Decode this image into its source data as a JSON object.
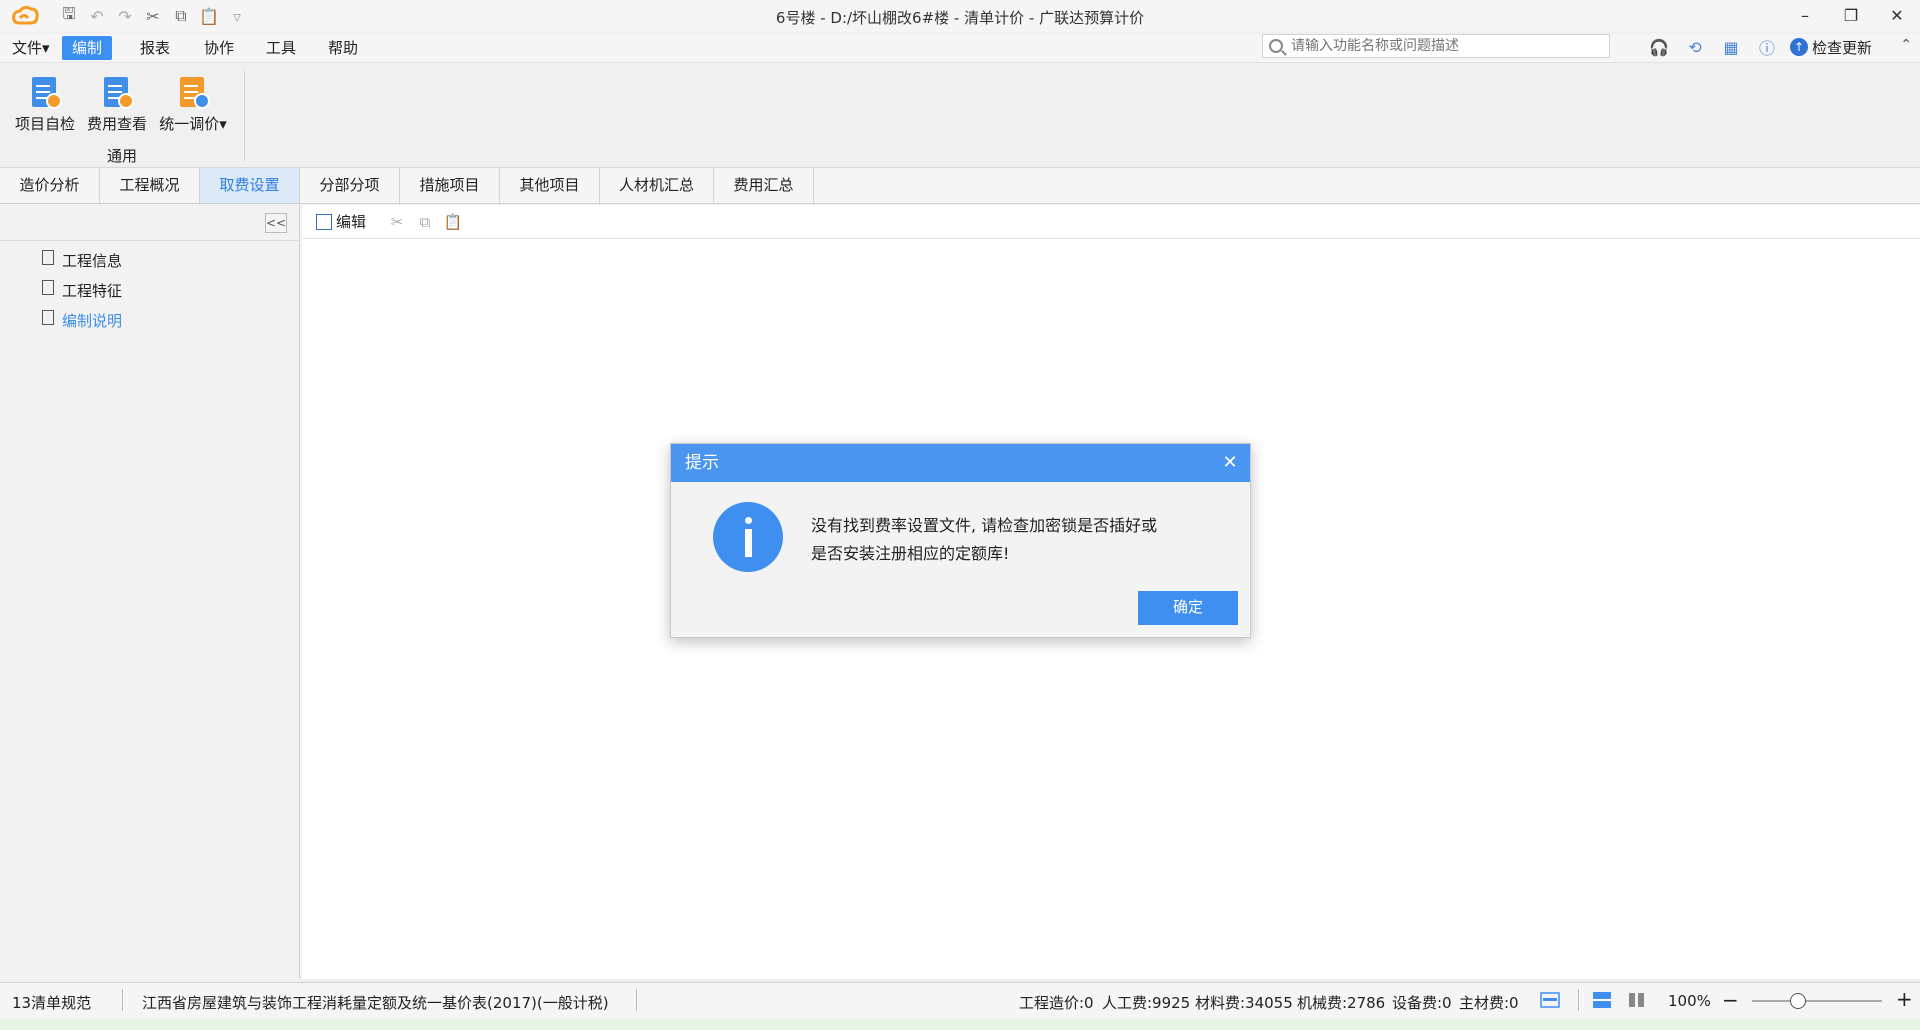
{
  "window": {
    "title": "6号楼 - D:/坏山棚改6#楼 - 清单计价 - 广联达预算计价",
    "minimize": "–",
    "restore": "❐",
    "close": "✕"
  },
  "menu": {
    "items": [
      "文件▾",
      "编制",
      "报表",
      "协作",
      "工具",
      "帮助"
    ],
    "active": "编制"
  },
  "search": {
    "placeholder": "请输入功能名称或问题描述"
  },
  "right_tools": {
    "update_label": "检查更新",
    "collapse": "⌃"
  },
  "ribbon": {
    "buttons": [
      {
        "label": "项目自检"
      },
      {
        "label": "费用查看"
      },
      {
        "label": "统一调价▾"
      }
    ],
    "group_label": "通用"
  },
  "tabs": [
    {
      "label": "造价分析"
    },
    {
      "label": "工程概况"
    },
    {
      "label": "取费设置"
    },
    {
      "label": "分部分项"
    },
    {
      "label": "措施项目"
    },
    {
      "label": "其他项目"
    },
    {
      "label": "人材机汇总"
    },
    {
      "label": "费用汇总"
    }
  ],
  "active_tab": "取费设置",
  "left_pane": {
    "collapse": "<<",
    "tree": [
      {
        "label": "工程信息"
      },
      {
        "label": "工程特征"
      },
      {
        "label": "编制说明"
      }
    ]
  },
  "toolbar": {
    "edit_label": "编辑"
  },
  "dialog": {
    "title": "提示",
    "close": "✕",
    "message_line1": "没有找到费率设置文件, 请检查加密锁是否插好或",
    "message_line2": "是否安装注册相应的定额库!",
    "ok_label": "确定"
  },
  "status": {
    "spec": "13清单规范",
    "quota": "江西省房屋建筑与装饰工程消耗量定额及统一基价表(2017)(一般计税)",
    "cost_total": "工程造价:0",
    "labor": "人工费:9925",
    "material": "材料费:34055",
    "machine": "机械费:2786",
    "equipment": "设备费:0",
    "main_material": "主材费:0",
    "zoom": "100%",
    "zoom_out": "−",
    "zoom_in": "+"
  }
}
